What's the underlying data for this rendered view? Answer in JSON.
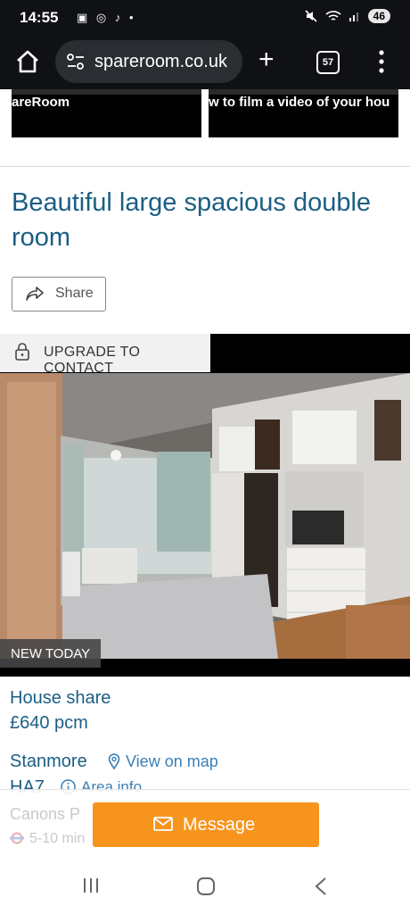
{
  "status_bar": {
    "time": "14:55",
    "notif_icons": "▣ ◎ ♪ •",
    "battery": "46"
  },
  "browser": {
    "url": "spareroom.co.uk",
    "tab_count": "57"
  },
  "thumbs": [
    {
      "text": "areRoom"
    },
    {
      "text": "w to film a video of your hou"
    }
  ],
  "listing": {
    "title": "Beautiful large spacious double room",
    "share_label": "Share",
    "upgrade_label": "UPGRADE TO CONTACT",
    "badge": "NEW TODAY",
    "property_type": "House share",
    "price": "£640 pcm",
    "area": "Stanmore",
    "view_on_map": "View on map",
    "postcode": "HA7",
    "area_info": "Area info",
    "station": "Canons P",
    "walk_time": "5-10 min"
  },
  "message_label": "Message",
  "colors": {
    "accent_blue": "#1b5e84",
    "link_blue": "#3a7fb6",
    "message_orange": "#f7941d"
  }
}
